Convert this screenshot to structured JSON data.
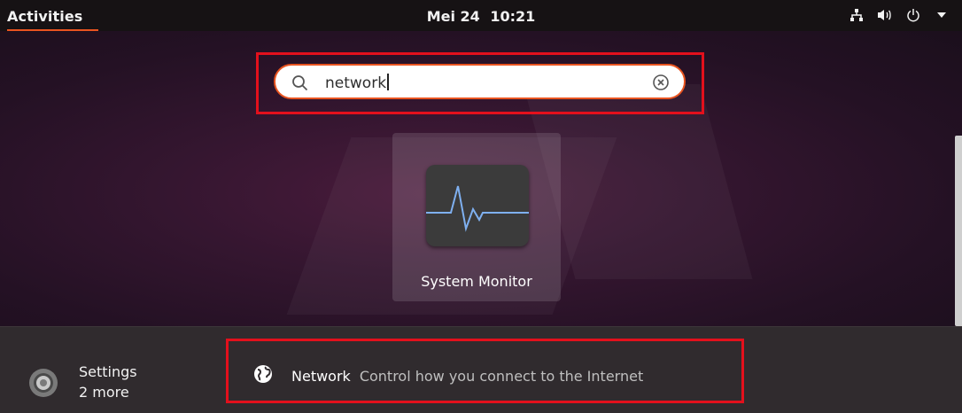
{
  "topbar": {
    "activities_label": "Activities",
    "date": "Mei 24",
    "time": "10:21",
    "tray_icons": [
      "network-icon",
      "volume-icon",
      "power-icon",
      "dropdown-arrow-icon"
    ]
  },
  "search": {
    "value": "network",
    "icon": "search-icon",
    "clear_icon": "clear-icon"
  },
  "app_results": [
    {
      "label": "System Monitor",
      "icon": "system-monitor-icon"
    }
  ],
  "providers": {
    "settings": {
      "name": "Settings",
      "more": "2 more",
      "icon": "settings-gear-icon"
    },
    "results": [
      {
        "name": "Network",
        "description": "Control how you connect to the Internet",
        "icon": "globe-icon"
      }
    ]
  },
  "colors": {
    "accent": "#e95420",
    "highlight_box": "#e3101c",
    "topbar": "#161214",
    "bottom_panel": "#302b2e"
  }
}
